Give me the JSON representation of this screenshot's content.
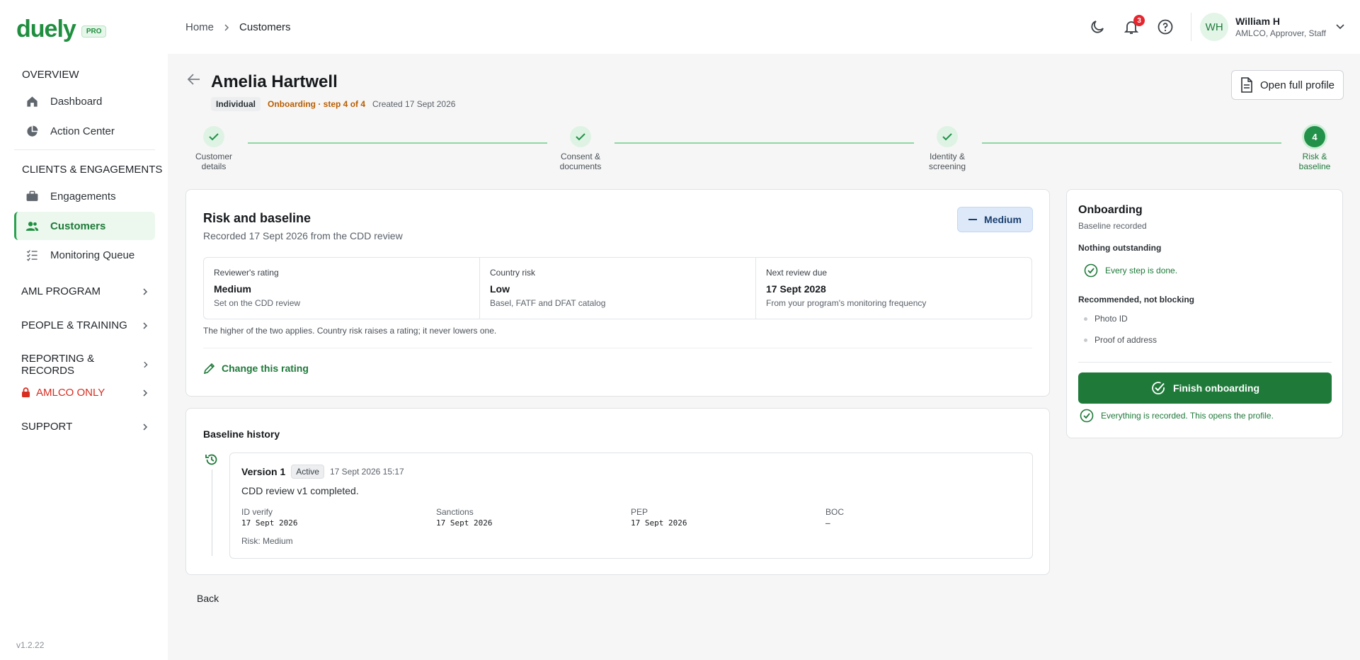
{
  "app": {
    "logo": "duely",
    "tier": "PRO",
    "version": "v1.2.22"
  },
  "sidebar": {
    "sections": [
      {
        "label": "OVERVIEW"
      },
      {
        "label": "CLIENTS & ENGAGEMENTS"
      }
    ],
    "items": [
      {
        "label": "Dashboard",
        "icon": "home-icon"
      },
      {
        "label": "Action Center",
        "icon": "pie-chart-icon"
      },
      {
        "label": "Engagements",
        "icon": "briefcase-icon"
      },
      {
        "label": "Customers",
        "icon": "users-icon",
        "active": true
      },
      {
        "label": "Monitoring Queue",
        "icon": "list-check-icon"
      }
    ],
    "groups": [
      {
        "label": "AML PROGRAM"
      },
      {
        "label": "PEOPLE & TRAINING"
      },
      {
        "label": "REPORTING & RECORDS"
      },
      {
        "label": "AMLCO ONLY",
        "icon": "lock-icon"
      },
      {
        "label": "SUPPORT"
      }
    ]
  },
  "topbar": {
    "breadcrumb": [
      "Home",
      "Customers"
    ],
    "notifications_count": "3",
    "user": {
      "initials": "WH",
      "name": "William H",
      "roles": "AMLCO, Approver, Staff"
    }
  },
  "header": {
    "title": "Amelia Hartwell",
    "type_chip": "Individual",
    "status": "Onboarding · step 4 of 4",
    "created": "Created 17 Sept 2026",
    "open_profile": "Open full profile"
  },
  "stepper": [
    {
      "label_line1": "Customer",
      "label_line2": "details",
      "done": true
    },
    {
      "label_line1": "Consent &",
      "label_line2": "documents",
      "done": true
    },
    {
      "label_line1": "Identity &",
      "label_line2": "screening",
      "done": true
    },
    {
      "label_line1": "Risk &",
      "label_line2": "baseline",
      "number": "4",
      "current": true
    }
  ],
  "risk": {
    "title": "Risk and baseline",
    "subtitle": "Recorded 17 Sept 2026 from the CDD review",
    "rating_pill": "Medium",
    "metrics": [
      {
        "label": "Reviewer's rating",
        "value": "Medium",
        "sub": "Set on the CDD review"
      },
      {
        "label": "Country risk",
        "value": "Low",
        "sub": "Basel, FATF and DFAT catalog"
      },
      {
        "label": "Next review due",
        "value": "17 Sept 2028",
        "sub": "From your program's monitoring frequency"
      }
    ],
    "note": "The higher of the two applies. Country risk raises a rating; it never lowers one.",
    "change_link": "Change this rating"
  },
  "history": {
    "title": "Baseline history",
    "version": {
      "name": "Version 1",
      "status": "Active",
      "time": "17 Sept 2026 15:17",
      "description": "CDD review v1 completed.",
      "checks": [
        {
          "label": "ID verify",
          "value": "17 Sept 2026"
        },
        {
          "label": "Sanctions",
          "value": "17 Sept 2026"
        },
        {
          "label": "PEP",
          "value": "17 Sept 2026"
        },
        {
          "label": "BOC",
          "value": "—"
        }
      ],
      "risk": "Risk: Medium"
    }
  },
  "back_label": "Back",
  "onboarding": {
    "title": "Onboarding",
    "subtitle": "Baseline recorded",
    "outstanding_heading": "Nothing outstanding",
    "outstanding_ok": "Every step is done.",
    "recommended_heading": "Recommended, not blocking",
    "recommended": [
      "Photo ID",
      "Proof of address"
    ],
    "finish_button": "Finish onboarding",
    "footer": "Everything is recorded. This opens the profile."
  },
  "colors": {
    "brand": "#1f7a3a",
    "accent_light": "#ecf8ee",
    "danger": "#d92d20",
    "medium_pill": "#dde9f9",
    "onboarding_status": "#b95d00"
  }
}
